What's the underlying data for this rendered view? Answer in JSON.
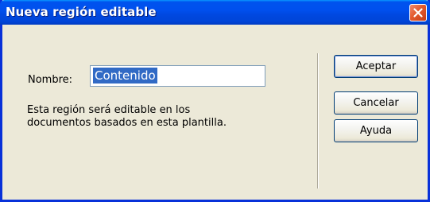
{
  "window": {
    "title": "Nueva región editable",
    "close_icon": "close-x-icon"
  },
  "form": {
    "name_label": "Nombre:",
    "name_value": "Contenido",
    "description_line1": "Esta región será editable en los",
    "description_line2": "documentos basados en esta plantilla."
  },
  "buttons": {
    "accept": "Aceptar",
    "cancel": "Cancelar",
    "help": "Ayuda"
  },
  "colors": {
    "titlebar": "#0053ee",
    "dialog_bg": "#ece9d8",
    "selection": "#316ac5",
    "close_button": "#e35a2e"
  }
}
